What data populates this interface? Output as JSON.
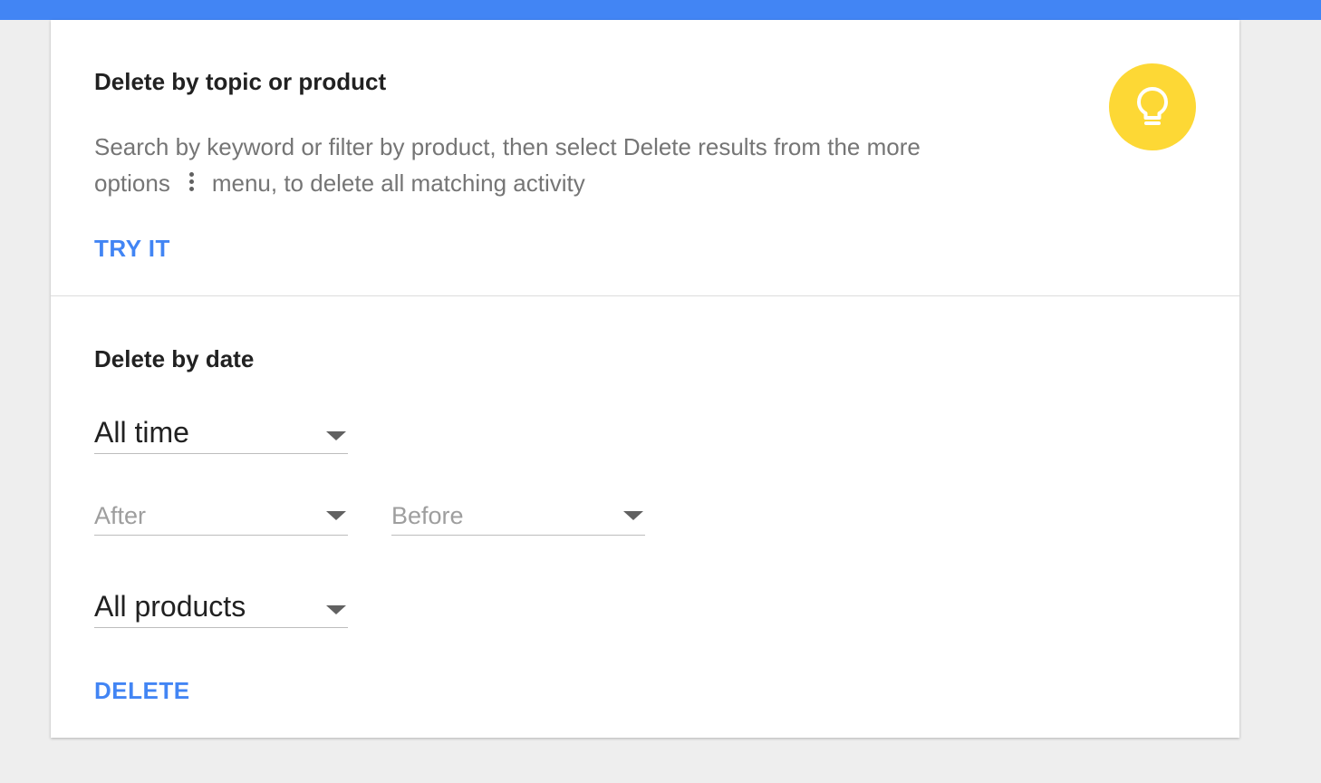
{
  "colors": {
    "accent": "#4285f4",
    "tip_circle": "#fdd835",
    "background": "#eeeeee"
  },
  "topic_section": {
    "title": "Delete by topic or product",
    "description_part1": "Search by keyword or filter by product, then select Delete results from the more options",
    "inline_icon": "more-vert-icon",
    "description_part2": "menu, to delete all matching activity",
    "action_label": "TRY IT",
    "tip_icon": "lightbulb-icon"
  },
  "date_section": {
    "title": "Delete by date",
    "range_select": {
      "value": "All time"
    },
    "after_select": {
      "placeholder": "After"
    },
    "before_select": {
      "placeholder": "Before"
    },
    "product_select": {
      "value": "All products"
    },
    "action_label": "DELETE"
  }
}
